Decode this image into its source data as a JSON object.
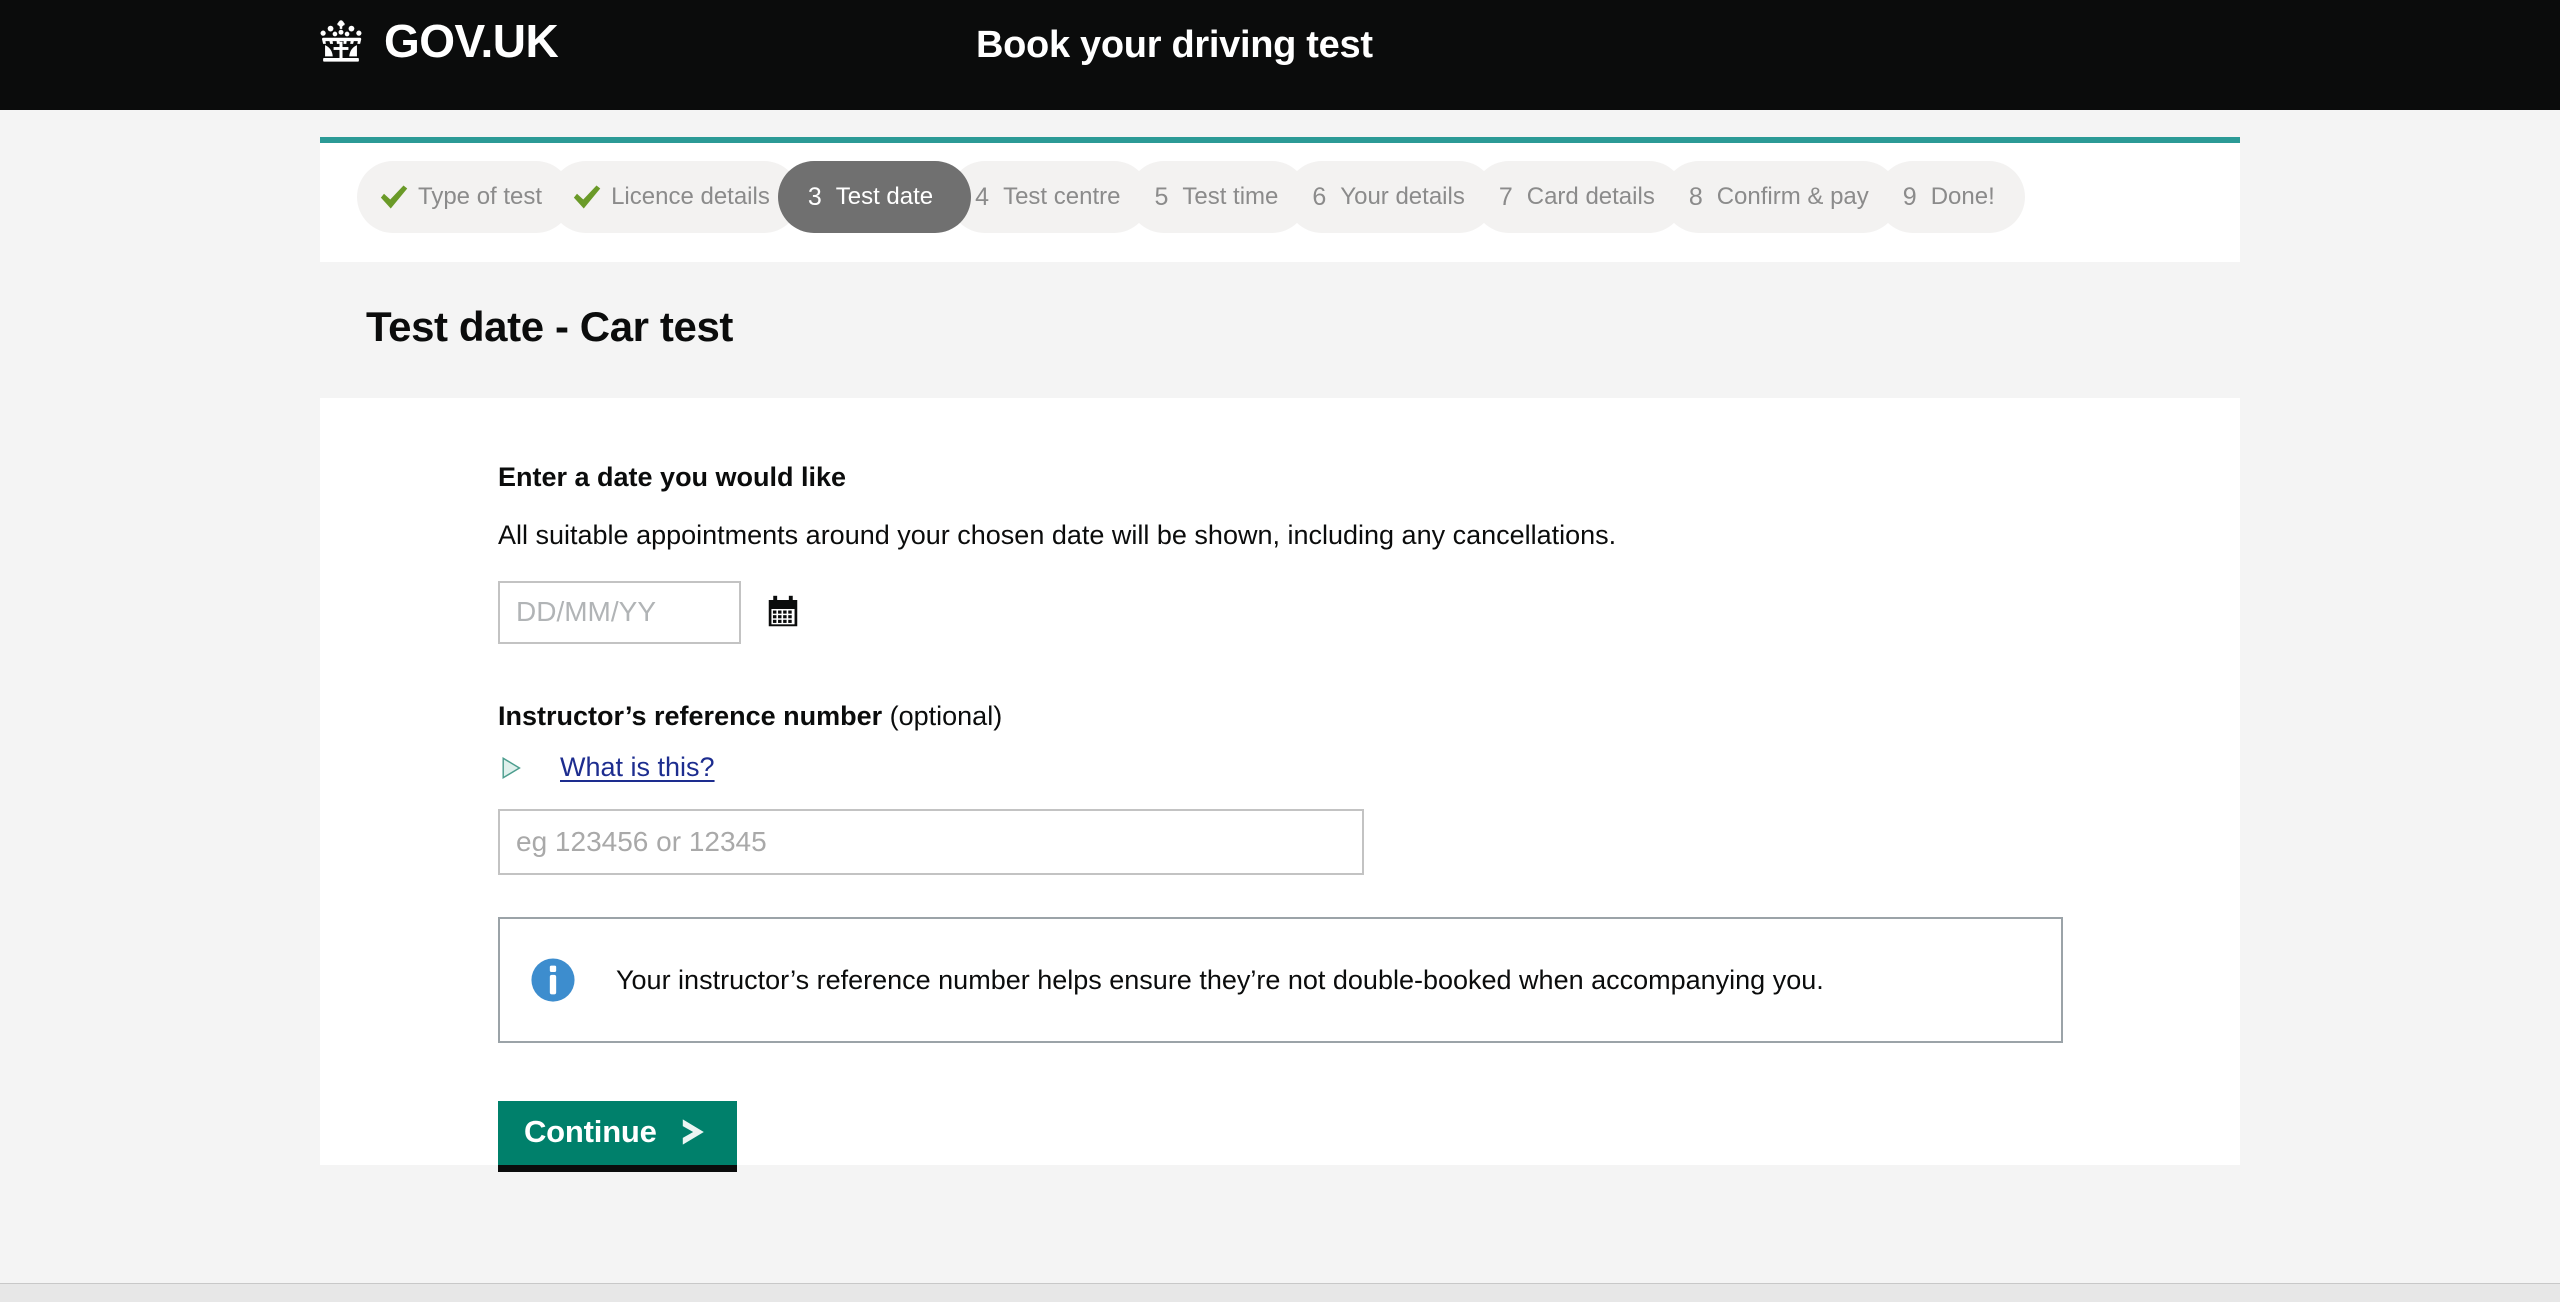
{
  "masthead": {
    "brand_text": "GOV.UK",
    "crown_icon": "crown-icon",
    "service_title": "Book your driving test"
  },
  "progress": {
    "steps": [
      {
        "num": "",
        "label": "Type of test",
        "state": "done"
      },
      {
        "num": "",
        "label": "Licence details",
        "state": "done"
      },
      {
        "num": "3",
        "label": "Test date",
        "state": "active"
      },
      {
        "num": "4",
        "label": "Test centre",
        "state": "todo"
      },
      {
        "num": "5",
        "label": "Test time",
        "state": "todo"
      },
      {
        "num": "6",
        "label": "Your details",
        "state": "todo"
      },
      {
        "num": "7",
        "label": "Card details",
        "state": "todo"
      },
      {
        "num": "8",
        "label": "Confirm & pay",
        "state": "todo"
      },
      {
        "num": "9",
        "label": "Done!",
        "state": "todo"
      }
    ]
  },
  "page": {
    "title": "Test date - Car test"
  },
  "form": {
    "date_legend": "Enter a date you would like",
    "date_hint": "All suitable appointments around your chosen date will be shown, including any cancellations.",
    "date_value": "",
    "date_placeholder": "DD/MM/YY",
    "calendar_icon": "calendar-icon",
    "instructor_legend": "Instructor’s reference number",
    "instructor_optional": " (optional)",
    "disclosure_icon": "triangle-right-icon",
    "disclosure_label": "What is this?",
    "ref_value": "",
    "ref_placeholder": "eg 123456 or 12345",
    "info_icon": "info-icon",
    "info_text": "Your instructor’s reference number helps ensure they’re not double-booked when accompanying you.",
    "continue_label": "Continue",
    "continue_chevron_icon": "chevron-right-icon"
  },
  "colors": {
    "masthead_bg": "#0b0c0c",
    "accent_teal": "#2b9a96",
    "active_step_bg": "#707070",
    "step_bg": "#f3f2f1",
    "button_green": "#00806b",
    "link_blue": "#1d2d8f",
    "tick_green": "#6a9a28",
    "info_blue": "#3d8dce"
  }
}
